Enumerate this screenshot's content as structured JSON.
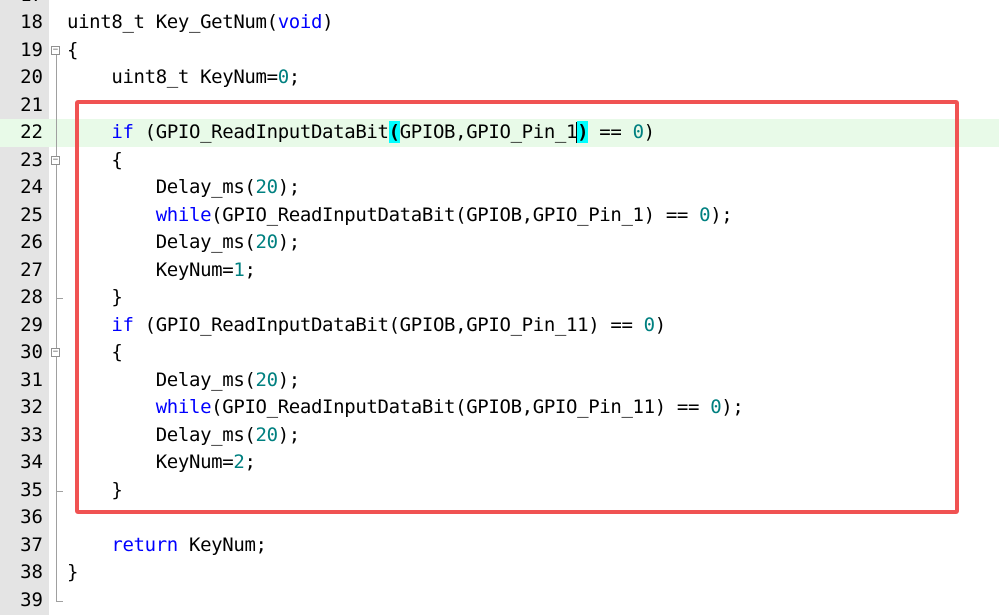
{
  "editor": {
    "partial_top_line_number": "17",
    "lines": [
      {
        "num": "18",
        "text": "uint8_t Key_GetNum(void)"
      },
      {
        "num": "19",
        "text": "{"
      },
      {
        "num": "20",
        "text": "    uint8_t KeyNum=0;"
      },
      {
        "num": "21",
        "text": ""
      },
      {
        "num": "22",
        "text": "    if (GPIO_ReadInputDataBit(GPIOB,GPIO_Pin_1) == 0)"
      },
      {
        "num": "23",
        "text": "    {"
      },
      {
        "num": "24",
        "text": "        Delay_ms(20);"
      },
      {
        "num": "25",
        "text": "        while(GPIO_ReadInputDataBit(GPIOB,GPIO_Pin_1) == 0);"
      },
      {
        "num": "26",
        "text": "        Delay_ms(20);"
      },
      {
        "num": "27",
        "text": "        KeyNum=1;"
      },
      {
        "num": "28",
        "text": "    }"
      },
      {
        "num": "29",
        "text": "    if (GPIO_ReadInputDataBit(GPIOB,GPIO_Pin_11) == 0)"
      },
      {
        "num": "30",
        "text": "    {"
      },
      {
        "num": "31",
        "text": "        Delay_ms(20);"
      },
      {
        "num": "32",
        "text": "        while(GPIO_ReadInputDataBit(GPIOB,GPIO_Pin_11) == 0);"
      },
      {
        "num": "33",
        "text": "        Delay_ms(20);"
      },
      {
        "num": "34",
        "text": "        KeyNum=2;"
      },
      {
        "num": "35",
        "text": "    }"
      },
      {
        "num": "36",
        "text": ""
      },
      {
        "num": "37",
        "text": "    return KeyNum;"
      },
      {
        "num": "38",
        "text": "}"
      },
      {
        "num": "39",
        "text": ""
      }
    ],
    "current_line": "22",
    "keywords": [
      "void",
      "if",
      "while",
      "return"
    ],
    "colors": {
      "keyword": "#0000ff",
      "number": "#008080",
      "current_line_bg": "#e8fae8",
      "bracket_match_bg": "#00ffff",
      "annotation_box": "#f05252",
      "gutter_bg": "#e4e4e4"
    }
  }
}
